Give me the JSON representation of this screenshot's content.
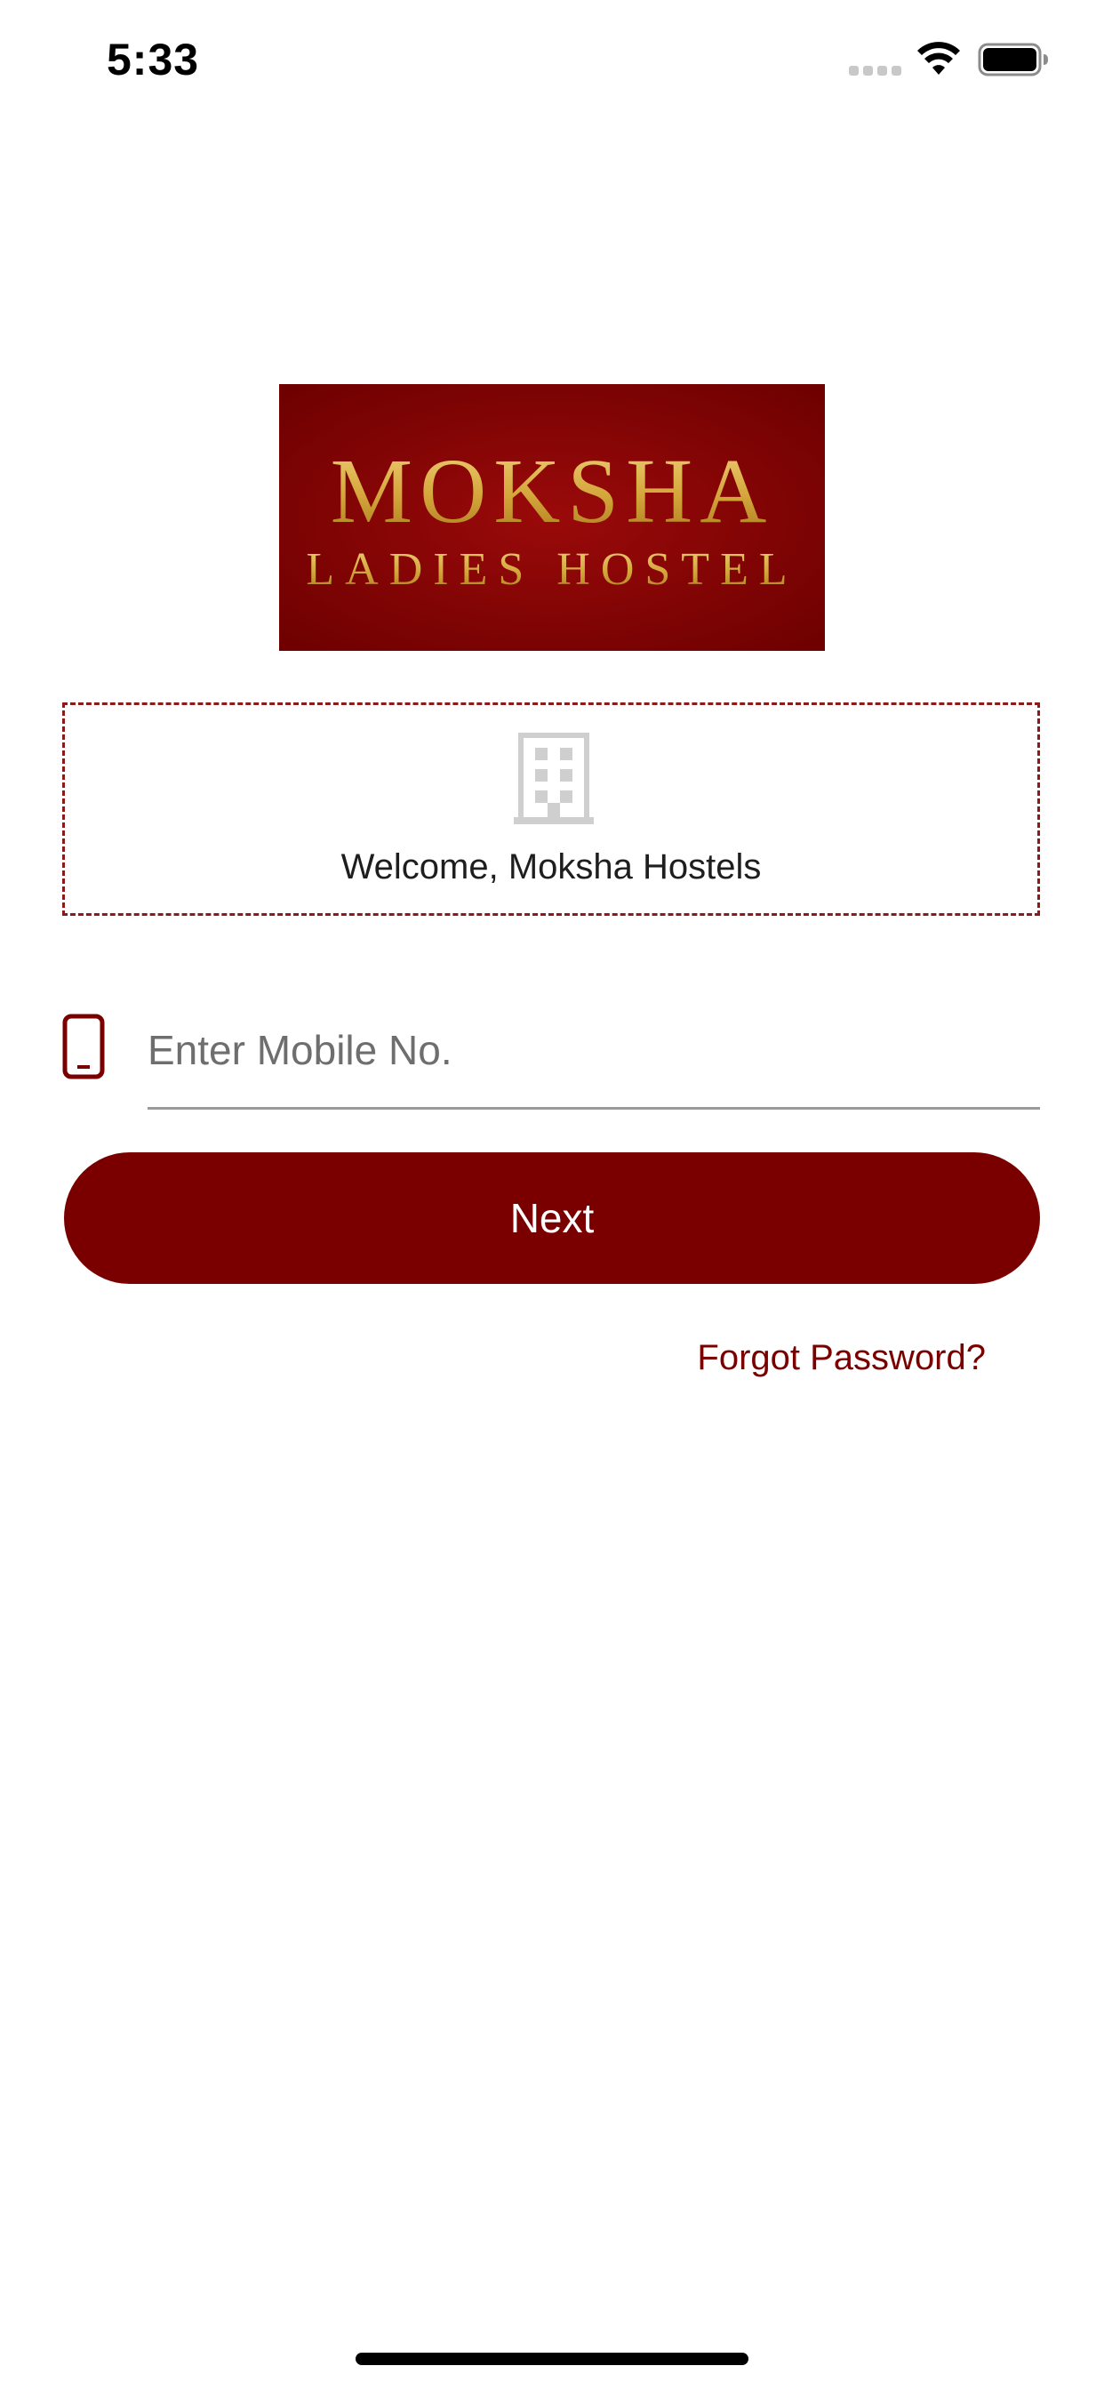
{
  "status_bar": {
    "time": "5:33",
    "icons": [
      "signal-dots-icon",
      "wifi-icon",
      "battery-icon"
    ]
  },
  "logo": {
    "line1": "MOKSHA",
    "line2": "LADIES HOSTEL",
    "background": "#8b0000",
    "text_color": "#d4a53a"
  },
  "welcome": {
    "icon": "building-icon",
    "text": "Welcome, Moksha Hostels"
  },
  "login": {
    "mobile_icon": "phone-icon",
    "mobile_placeholder": "Enter Mobile No.",
    "mobile_value": "",
    "next_label": "Next",
    "forgot_label": "Forgot Password?"
  },
  "colors": {
    "accent": "#7a0000",
    "card_border": "#8b1a1a",
    "muted_icon": "#c8c8c8"
  }
}
